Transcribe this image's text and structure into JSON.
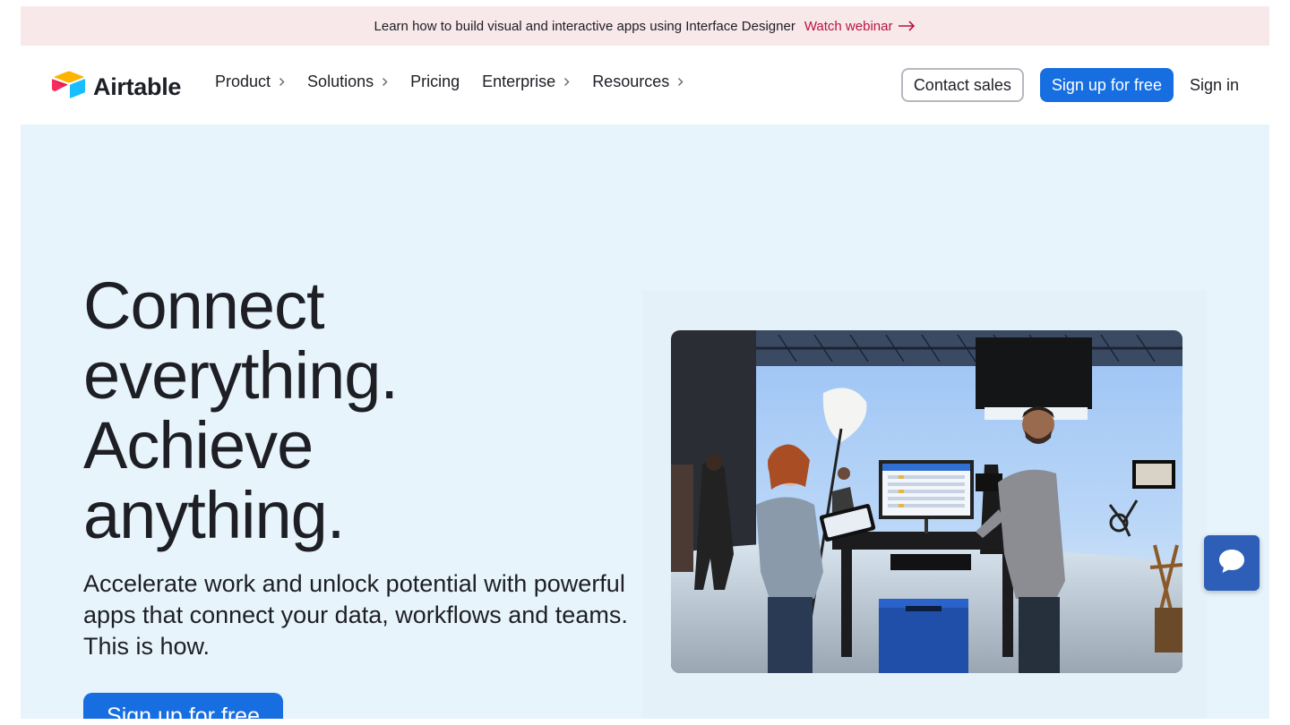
{
  "announcement": {
    "message": "Learn how to build visual and interactive apps using Interface Designer",
    "cta_label": "Watch webinar",
    "cta_icon": "arrow-right-icon"
  },
  "nav": {
    "logo_text": "Airtable",
    "items": [
      {
        "label": "Product",
        "has_submenu": true
      },
      {
        "label": "Solutions",
        "has_submenu": true
      },
      {
        "label": "Pricing",
        "has_submenu": false
      },
      {
        "label": "Enterprise",
        "has_submenu": true
      },
      {
        "label": "Resources",
        "has_submenu": true
      }
    ],
    "contact_sales_label": "Contact sales",
    "signup_label": "Sign up for free",
    "signin_label": "Sign in"
  },
  "hero": {
    "headline_lines": [
      "Connect",
      "everything.",
      "Achieve",
      "anything."
    ],
    "subhead": "Accelerate work and unlock potential with powerful apps that connect your data, workflows and teams. This is how.",
    "cta_label": "Sign up for free",
    "image_alt": "studio-photo"
  },
  "chat": {
    "icon": "chat-bubble-icon"
  },
  "colors": {
    "accent": "#166ee1",
    "announcement_bg": "#f8e8ea",
    "announcement_link": "#b8143f",
    "hero_bg": "#e8f4fb",
    "chat_bg": "#2d5fb8"
  }
}
